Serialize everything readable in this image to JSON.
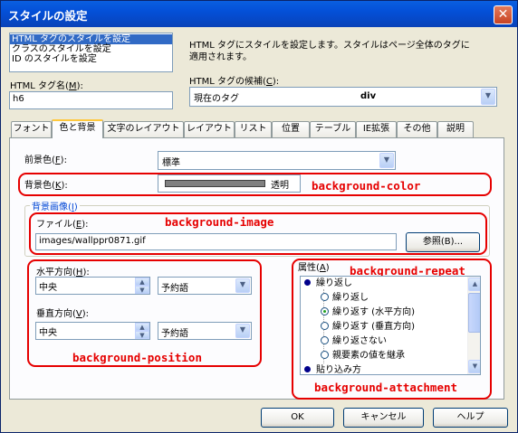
{
  "window": {
    "title": "スタイルの設定",
    "close_glyph": "✕"
  },
  "target_list": {
    "items": [
      "HTML タグのスタイルを設定",
      "クラスのスタイルを設定",
      "ID のスタイルを設定"
    ],
    "selected_index": 0
  },
  "description": {
    "line1": "HTML タグにスタイルを設定します。スタイルはページ全体のタグに",
    "line2": "適用されます。"
  },
  "tag_name": {
    "label_pre": "HTML タグ名(",
    "label_key": "M",
    "label_post": "):",
    "value": "h6"
  },
  "candidates": {
    "label_pre": "HTML タグの候補(",
    "label_key": "C",
    "label_post": "):",
    "value": "現在のタグ",
    "value2": "div"
  },
  "tabs": [
    "フォント",
    "色と背景",
    "文字のレイアウト",
    "レイアウト",
    "リスト",
    "位置",
    "テーブル",
    "IE拡張",
    "その他",
    "説明"
  ],
  "active_tab": 1,
  "foreground": {
    "label_pre": "前景色(",
    "label_key": "F",
    "label_post": "):",
    "value": "標準"
  },
  "background_color": {
    "label_pre": "背景色(",
    "label_key": "K",
    "label_post": "):",
    "value": "透明",
    "swatch_color": "#808080",
    "annotation": "background-color"
  },
  "background_image": {
    "group_label_pre": "背景画像(",
    "group_label_key": "I",
    "group_label_post": ")",
    "file_label_pre": "ファイル(",
    "file_label_key": "E",
    "file_label_post": "):",
    "file_value": "images/wallppr0871.gif",
    "browse_label": "参照(B)...",
    "annotation": "background-image"
  },
  "position": {
    "horizontal_label_pre": "水平方向(",
    "horizontal_label_key": "H",
    "horizontal_label_post": "):",
    "horizontal_value": "中央",
    "horizontal_unit": "予約語",
    "vertical_label_pre": "垂直方向(",
    "vertical_label_key": "V",
    "vertical_label_post": "):",
    "vertical_value": "中央",
    "vertical_unit": "予約語",
    "annotation": "background-position"
  },
  "attributes": {
    "label_pre": "属性(",
    "label_key": "A",
    "label_post": ")",
    "repeat_header": "繰り返し",
    "options": [
      "繰り返し",
      "繰り返す (水平方向)",
      "繰り返す (垂直方向)",
      "繰り返さない",
      "親要素の値を継承"
    ],
    "selected_index": 1,
    "attach_header": "貼り込み方",
    "annotation_repeat": "background-repeat",
    "annotation_attachment": "background-attachment"
  },
  "buttons": {
    "ok": "OK",
    "cancel": "キャンセル",
    "help": "ヘルプ"
  },
  "colors": {
    "annotation_red": "#e60000",
    "title_blue": "#0450d8",
    "selection": "#316ac5"
  }
}
